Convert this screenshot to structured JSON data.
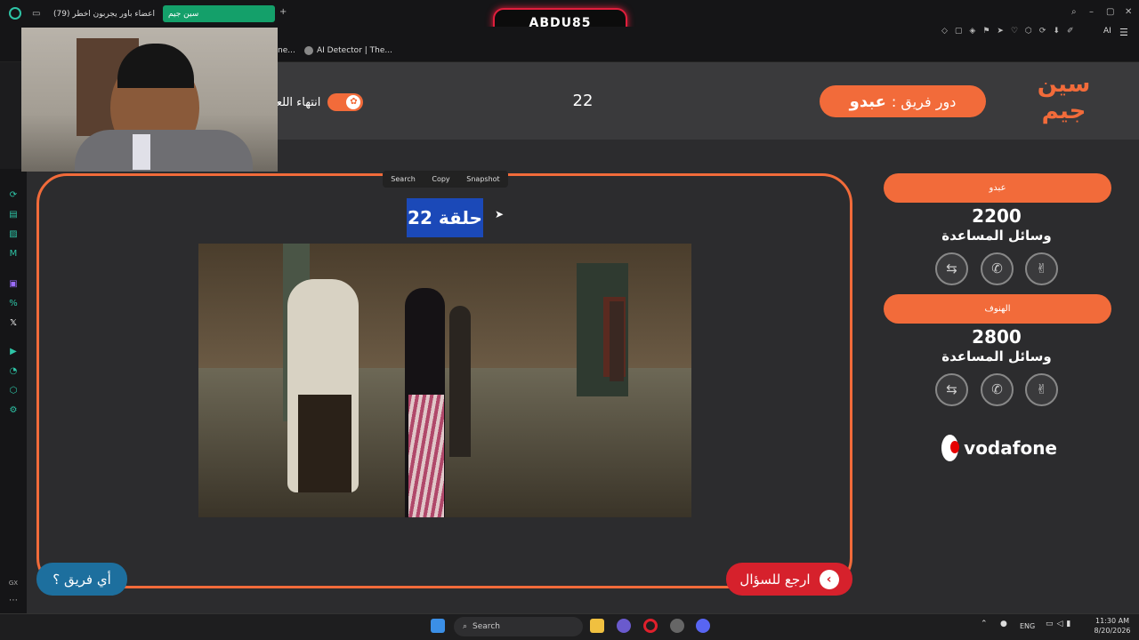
{
  "browser": {
    "active_tab": "سين جيم",
    "other_tab": "(79) اعضاء باور يجربون اخطر",
    "gamer_badge": "ABDU85",
    "bookmark_ai": "AI Detector | The...",
    "bookmark_partial": "ne..."
  },
  "header": {
    "logo_text": "سين جيم",
    "turn_label": "دور فريق :",
    "turn_team": "عبدو",
    "round_number": "22",
    "end_game_label": "انتهاء اللعبة"
  },
  "main": {
    "episode_title": "حلقة 22",
    "selection_menu": [
      "Search",
      "Copy",
      "Snapshot"
    ],
    "back_button": "ارجع للسؤال",
    "which_team_button": "أي فريق ؟"
  },
  "teams": [
    {
      "name": "عبدو",
      "score": "2200",
      "aids_label": "وسائل المساعدة"
    },
    {
      "name": "الهنوف",
      "score": "2800",
      "aids_label": "وسائل المساعدة"
    }
  ],
  "sponsor": "vodafone",
  "taskbar": {
    "search": "Search",
    "lang": "ENG",
    "time": "11:30 AM",
    "date": "8/20/2026"
  },
  "colors": {
    "accent": "#f26b3a",
    "back_button": "#d6212c",
    "which_team": "#1d6f9e",
    "highlight": "#1b49b8"
  }
}
